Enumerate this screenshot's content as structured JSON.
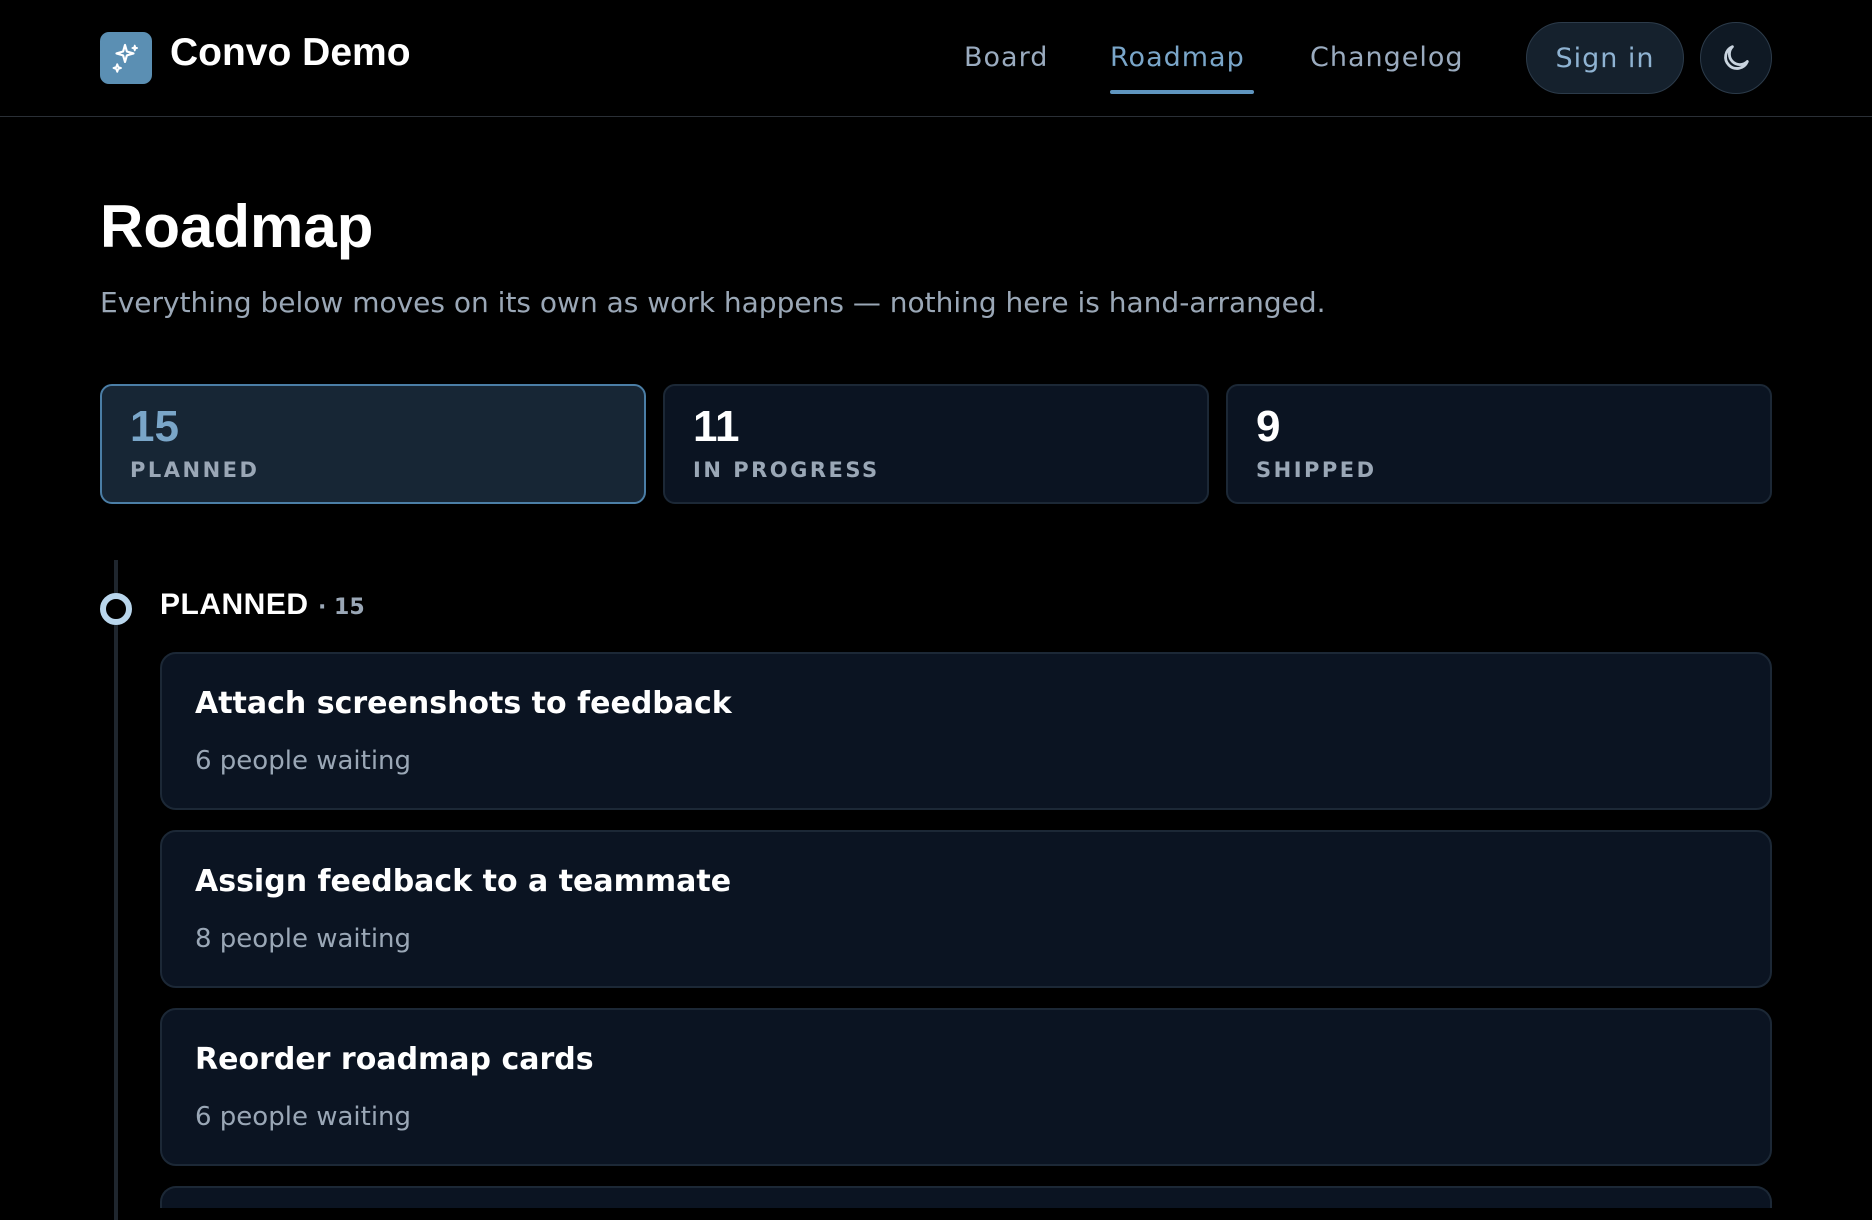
{
  "header": {
    "brand": "Convo Demo",
    "logo_icon": "sparkles-icon",
    "nav": [
      {
        "label": "Board",
        "active": false
      },
      {
        "label": "Roadmap",
        "active": true
      },
      {
        "label": "Changelog",
        "active": false
      }
    ],
    "sign_in_label": "Sign in",
    "theme_icon": "moon-icon"
  },
  "page": {
    "title": "Roadmap",
    "subtitle": "Everything below moves on its own as work happens — nothing here is hand-arranged."
  },
  "stats": [
    {
      "value": "15",
      "label": "PLANNED",
      "selected": true
    },
    {
      "value": "11",
      "label": "IN PROGRESS",
      "selected": false
    },
    {
      "value": "9",
      "label": "SHIPPED",
      "selected": false
    }
  ],
  "section": {
    "title": "PLANNED",
    "count": "· 15",
    "items": [
      {
        "title": "Attach screenshots to feedback",
        "meta": "6 people waiting"
      },
      {
        "title": "Assign feedback to a teammate",
        "meta": "8 people waiting"
      },
      {
        "title": "Reorder roadmap cards",
        "meta": "6 people waiting"
      }
    ]
  },
  "colors": {
    "background": "#000000",
    "card": "#0b1422",
    "accent": "#7aa6c9",
    "logo": "#5b8fb3"
  }
}
